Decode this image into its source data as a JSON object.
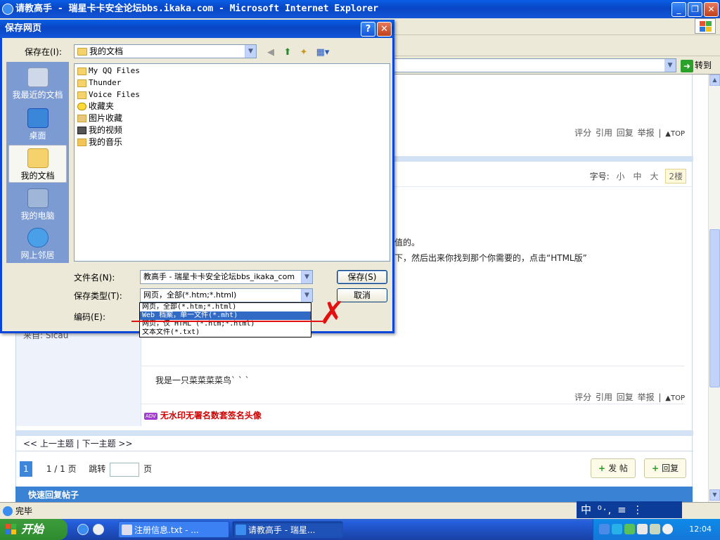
{
  "window": {
    "title": "请教高手 - 瑞星卡卡安全论坛bbs.ikaka.com - Microsoft Internet Explorer",
    "minimize": "_",
    "maximize": "❐",
    "close": "✕"
  },
  "address_bar": {
    "go_label": "转到",
    "go_arrow": "➜"
  },
  "status_bar": {
    "text": "完毕"
  },
  "ime": {
    "text": "中 ⁰·, ≡ ⋮"
  },
  "forum": {
    "post_actions": "评分 引用 回复 举报 |",
    "top_label": "▲TOP",
    "font_size_label": "字号:",
    "font_small": "小",
    "font_medium": "中",
    "font_large": "大",
    "floor": "2楼",
    "from_label": "来自: Sicau",
    "body_line_1": "值的。",
    "body_line_2": "下，然后出来你找到那个你需要的，点击“HTML版”",
    "signature": "我是一只菜菜菜菜鸟` ` `",
    "adv_tag": "ADV",
    "adv_text": "无水印无署名数套签名头像",
    "nav_prev_next": "<< 上一主题 | 下一主题 >>",
    "page_current": "1",
    "page_info": "1 / 1 页",
    "jump_label": "跳转",
    "page_unit": "页",
    "new_post": "发 帖",
    "reply": "回复",
    "quick_reply": "快速回复帖子"
  },
  "dialog": {
    "title": "保存网页",
    "help": "?",
    "close": "✕",
    "save_in_label": "保存在(I):",
    "save_in_value": "我的文档",
    "places": [
      {
        "label": "我最近的文档",
        "icon": "recent-documents-icon"
      },
      {
        "label": "桌面",
        "icon": "desktop-icon"
      },
      {
        "label": "我的文档",
        "icon": "my-documents-icon"
      },
      {
        "label": "我的电脑",
        "icon": "my-computer-icon"
      },
      {
        "label": "网上邻居",
        "icon": "network-places-icon"
      }
    ],
    "files": [
      {
        "name": "My QQ Files",
        "icon": "folder-icon"
      },
      {
        "name": "Thunder",
        "icon": "folder-icon"
      },
      {
        "name": "Voice Files",
        "icon": "folder-icon"
      },
      {
        "name": "收藏夹",
        "icon": "favorites-star-icon"
      },
      {
        "name": "图片收藏",
        "icon": "pictures-folder-icon"
      },
      {
        "name": "我的视频",
        "icon": "videos-folder-icon"
      },
      {
        "name": "我的音乐",
        "icon": "music-folder-icon"
      }
    ],
    "filename_label": "文件名(N):",
    "filename_value": "教高手 - 瑞星卡卡安全论坛bbs_ikaka_com",
    "filetype_label": "保存类型(T):",
    "filetype_value": "网页，全部(*.htm;*.html)",
    "encoding_label": "编码(E):",
    "save_button": "保存(S)",
    "cancel_button": "取消",
    "filetype_options": [
      "网页，全部(*.htm;*.html)",
      "Web 档案，单一文件(*.mht)",
      "网页，仅 HTML (*.htm;*.html)",
      "文本文件(*.txt)"
    ],
    "highlighted_option_index": 1
  },
  "taskbar": {
    "start_label": "开始",
    "tasks": [
      {
        "label": "注册信息.txt - ...",
        "active": false
      },
      {
        "label": "请教高手 - 瑞星...",
        "active": true
      }
    ],
    "clock": "12:04"
  },
  "colors": {
    "xp_blue": "#0a46d8",
    "highlight": "#316ac5",
    "annotation_red": "#e31010",
    "forum_blue": "#3a82d4"
  }
}
